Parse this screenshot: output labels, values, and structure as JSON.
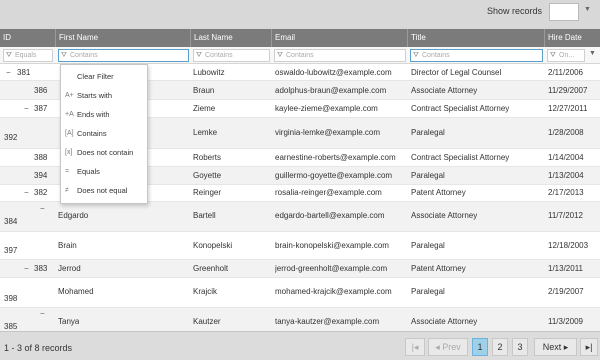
{
  "toolbar": {
    "show_label": "Show  records",
    "page_size_value": ""
  },
  "columns": [
    {
      "key": "id",
      "label": "ID"
    },
    {
      "key": "first_name",
      "label": "First Name"
    },
    {
      "key": "last_name",
      "label": "Last Name"
    },
    {
      "key": "email",
      "label": "Email"
    },
    {
      "key": "title",
      "label": "Title"
    },
    {
      "key": "hire_date",
      "label": "Hire Date"
    }
  ],
  "filters": {
    "id": "Equals",
    "first_name": "Contains",
    "last_name": "Contains",
    "email": "Contains",
    "title": "Contains",
    "hire_date": "On..."
  },
  "filter_menu": {
    "items": [
      {
        "label": "Clear Filter",
        "icon": ""
      },
      {
        "label": "Starts with",
        "icon": "A+"
      },
      {
        "label": "Ends with",
        "icon": "+A"
      },
      {
        "label": "Contains",
        "icon": "[A]"
      },
      {
        "label": "Does not contain",
        "icon": "[x]"
      },
      {
        "label": "Equals",
        "icon": "="
      },
      {
        "label": "Does not equal",
        "icon": "≠"
      }
    ]
  },
  "rows": [
    {
      "id": "381",
      "first_name": "",
      "last_name": "Lubowitz",
      "email": "oswaldo-lubowitz@example.com",
      "title": "Director of Legal Counsel",
      "hire_date": "2/11/2006"
    },
    {
      "id": "386",
      "first_name": "",
      "last_name": "Braun",
      "email": "adolphus-braun@example.com",
      "title": "Associate Attorney",
      "hire_date": "11/29/2007"
    },
    {
      "id": "387",
      "first_name": "",
      "last_name": "Zieme",
      "email": "kaylee-zieme@example.com",
      "title": "Contract Specialist Attorney",
      "hire_date": "12/27/2011"
    },
    {
      "id": "392",
      "first_name": "",
      "last_name": "Lemke",
      "email": "virginia-lemke@example.com",
      "title": "Paralegal",
      "hire_date": "1/28/2008"
    },
    {
      "id": "388",
      "first_name": "",
      "last_name": "Roberts",
      "email": "earnestine-roberts@example.com",
      "title": "Contract Specialist Attorney",
      "hire_date": "1/14/2004"
    },
    {
      "id": "394",
      "first_name": "",
      "last_name": "Goyette",
      "email": "guillermo-goyette@example.com",
      "title": "Paralegal",
      "hire_date": "1/13/2004"
    },
    {
      "id": "382",
      "first_name": "",
      "last_name": "Reinger",
      "email": "rosalia-reinger@example.com",
      "title": "Patent Attorney",
      "hire_date": "2/17/2013"
    },
    {
      "id": "384",
      "first_name": "Edgardo",
      "last_name": "Bartell",
      "email": "edgardo-bartell@example.com",
      "title": "Associate Attorney",
      "hire_date": "11/7/2012"
    },
    {
      "id": "397",
      "first_name": "Brain",
      "last_name": "Konopelski",
      "email": "brain-konopelski@example.com",
      "title": "Paralegal",
      "hire_date": "12/18/2003"
    },
    {
      "id": "383",
      "first_name": "Jerrod",
      "last_name": "Greenholt",
      "email": "jerrod-greenholt@example.com",
      "title": "Patent Attorney",
      "hire_date": "1/13/2011"
    },
    {
      "id": "398",
      "first_name": "Mohamed",
      "last_name": "Krajcik",
      "email": "mohamed-krajcik@example.com",
      "title": "Paralegal",
      "hire_date": "2/19/2007"
    },
    {
      "id": "385",
      "first_name": "Tanya",
      "last_name": "Kautzer",
      "email": "tanya-kautzer@example.com",
      "title": "Associate Attorney",
      "hire_date": "11/3/2009"
    }
  ],
  "footer": {
    "summary": "1 - 3 of 8 records",
    "prev_label": "Prev",
    "next_label": "Next",
    "pages": [
      "1",
      "2",
      "3"
    ],
    "active_page": "1"
  },
  "colors": {
    "header_bg": "#7b7b7b",
    "active_page": "#9fd0ea"
  }
}
